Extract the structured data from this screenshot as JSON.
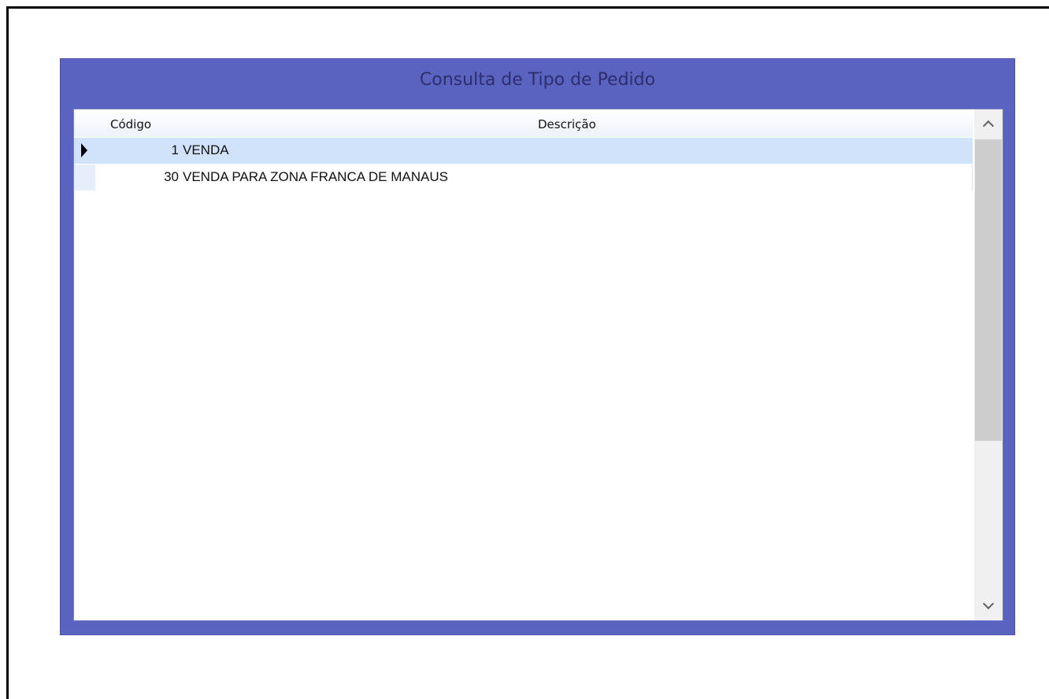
{
  "dialog": {
    "title": "Consulta de Tipo de Pedido"
  },
  "grid": {
    "columns": {
      "codigo": "Código",
      "descricao": "Descrição"
    },
    "rows": [
      {
        "codigo": "1",
        "descricao": "VENDA",
        "selected": true
      },
      {
        "codigo": "30",
        "descricao": "VENDA PARA ZONA FRANCA DE MANAUS",
        "selected": false
      }
    ]
  },
  "scrollbar": {
    "up_icon": "chevron-up-icon",
    "down_icon": "chevron-down-icon"
  },
  "colors": {
    "panel": "#5b63c0",
    "selected_row": "#d1e3fb",
    "title_text": "#2b2f6b"
  }
}
